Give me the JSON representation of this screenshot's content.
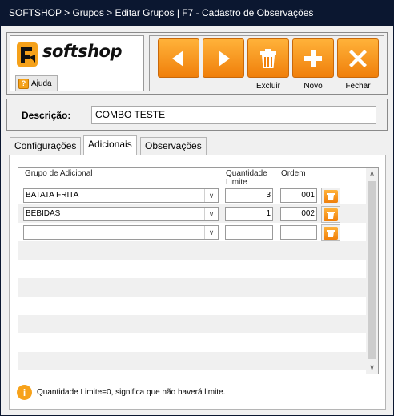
{
  "window": {
    "title": "SOFTSHOP > Grupos > Editar Grupos | F7 - Cadastro de Observações"
  },
  "brand": {
    "logo_text": "softshop"
  },
  "help": {
    "label": "Ajuda"
  },
  "toolbar": {
    "prev_label": "",
    "next_label": "",
    "delete_label": "Excluir",
    "new_label": "Novo",
    "close_label": "Fechar"
  },
  "description": {
    "label": "Descrição:",
    "value": "COMBO TESTE"
  },
  "tabs": [
    {
      "label": "Configurações",
      "active": false
    },
    {
      "label": "Adicionais",
      "active": true
    },
    {
      "label": "Observações",
      "active": false
    }
  ],
  "grid": {
    "headers": {
      "group": "Grupo de Adicional",
      "qty": "Quantidade Limite",
      "order": "Ordem"
    },
    "rows": [
      {
        "group": "BATATA FRITA",
        "qty": "3",
        "order": "001"
      },
      {
        "group": "BEBIDAS",
        "qty": "1",
        "order": "002"
      },
      {
        "group": "",
        "qty": "",
        "order": ""
      }
    ]
  },
  "info": {
    "text": "Quantidade Limite=0, significa que não haverá limite."
  },
  "colors": {
    "accent": "#f59a1a",
    "titlebar": "#0b1730"
  },
  "icons": [
    "prev-arrow-icon",
    "next-arrow-icon",
    "trash-icon",
    "plus-icon",
    "close-x-icon",
    "help-icon",
    "info-icon",
    "dropdown-chevron-icon"
  ]
}
